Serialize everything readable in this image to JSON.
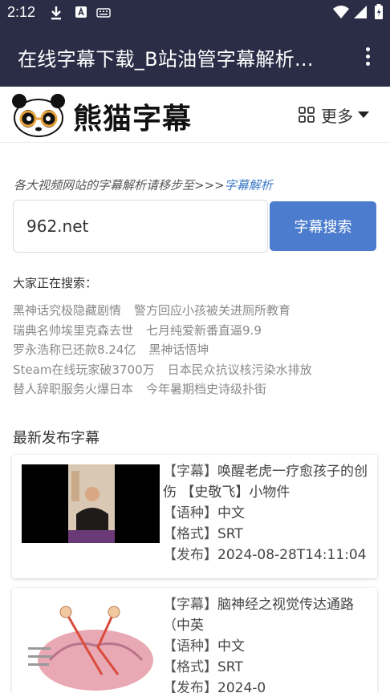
{
  "status_bar": {
    "time": "2:12"
  },
  "app_bar": {
    "title": "在线字幕下载_B站油管字幕解析..."
  },
  "header": {
    "logo_text": "熊猫字幕",
    "more_label": "更多"
  },
  "hint": {
    "text": "各大视频网站的字幕解析请移步至>>>",
    "link": "字幕解析"
  },
  "search": {
    "value": "962.net",
    "button": "字幕搜索"
  },
  "hot": {
    "title": "大家正在搜索：",
    "rows": [
      [
        "黑神话究极隐藏剧情",
        "警方回应小孩被关进厕所教育"
      ],
      [
        "瑞典名帅埃里克森去世",
        "七月纯爱新番直逼9.9"
      ],
      [
        "罗永浩称已还款8.24亿",
        "黑神话悟坤"
      ],
      [
        "Steam在线玩家破3700万",
        "日本民众抗议核污染水排放"
      ],
      [
        "替人辞职服务火爆日本",
        "今年暑期档史诗级扑街"
      ]
    ]
  },
  "latest": {
    "title": "最新发布字幕",
    "items": [
      {
        "label_title": "【字幕】",
        "title": "唤醒老虎一疗愈孩子的创伤 【史敬飞】小物件",
        "label_lang": "【语种】",
        "lang": "中文",
        "label_format": "【格式】",
        "format": "SRT",
        "label_date": "【发布】",
        "date": "2024-08-28T14:11:04"
      },
      {
        "label_title": "【字幕】",
        "title": "脑神经之视觉传达通路（中英",
        "label_lang": "【语种】",
        "lang": "中文",
        "label_format": "【格式】",
        "format": "SRT",
        "label_date": "【发布】",
        "date": "2024-0"
      }
    ]
  },
  "colors": {
    "appbar": "#2b2d47",
    "button": "#4b7ccd",
    "link": "#3c79c7"
  },
  "icons": [
    "download-icon",
    "text-a-icon",
    "keyboard-icon",
    "wifi-icon",
    "signal-icon",
    "battery-icon",
    "more-vert-icon",
    "panda-logo-icon",
    "grid-icon",
    "caret-down-icon"
  ]
}
